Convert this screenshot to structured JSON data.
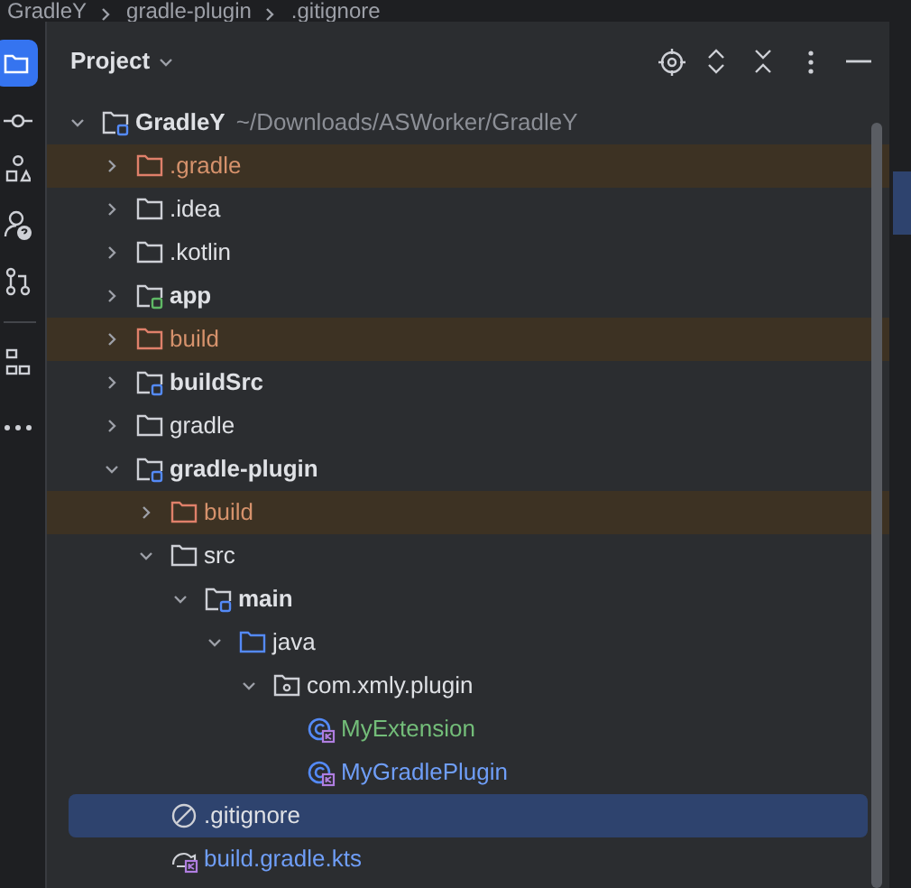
{
  "breadcrumb": [
    "GradleY",
    "gradle-plugin",
    ".gitignore"
  ],
  "panel": {
    "title": "Project"
  },
  "tree": [
    {
      "label": "GradleY",
      "path": "~/Downloads/ASWorker/GradleY",
      "kind": "module",
      "expanded": true,
      "selected": false,
      "children": [
        {
          "label": ".gradle",
          "kind": "excluded",
          "expanded": false,
          "selected": false
        },
        {
          "label": ".idea",
          "kind": "folder",
          "expanded": false,
          "selected": false
        },
        {
          "label": ".kotlin",
          "kind": "folder",
          "expanded": false,
          "selected": false
        },
        {
          "label": "app",
          "kind": "app-module",
          "expanded": false,
          "selected": false
        },
        {
          "label": "build",
          "kind": "excluded",
          "expanded": false,
          "selected": false
        },
        {
          "label": "buildSrc",
          "kind": "module",
          "expanded": false,
          "selected": false
        },
        {
          "label": "gradle",
          "kind": "folder",
          "expanded": false,
          "selected": false
        },
        {
          "label": "gradle-plugin",
          "kind": "module",
          "expanded": true,
          "selected": false,
          "children": [
            {
              "label": "build",
              "kind": "excluded",
              "expanded": false,
              "selected": false
            },
            {
              "label": "src",
              "kind": "folder",
              "expanded": true,
              "selected": false,
              "children": [
                {
                  "label": "main",
                  "kind": "module",
                  "expanded": true,
                  "selected": false,
                  "children": [
                    {
                      "label": "java",
                      "kind": "source",
                      "expanded": true,
                      "selected": false,
                      "children": [
                        {
                          "label": "com.xmly.plugin",
                          "kind": "package",
                          "expanded": true,
                          "selected": false,
                          "children": [
                            {
                              "label": "MyExtension",
                              "kind": "class",
                              "color": "#73bd79",
                              "selected": false
                            },
                            {
                              "label": "MyGradlePlugin",
                              "kind": "class",
                              "color": "#6f9ef8",
                              "selected": false
                            }
                          ]
                        }
                      ]
                    }
                  ]
                }
              ]
            },
            {
              "label": ".gitignore",
              "kind": "ignore",
              "selected": true
            },
            {
              "label": "build.gradle.kts",
              "kind": "gradle-script",
              "color": "#6f9ef8",
              "selected": false
            }
          ]
        }
      ]
    }
  ]
}
